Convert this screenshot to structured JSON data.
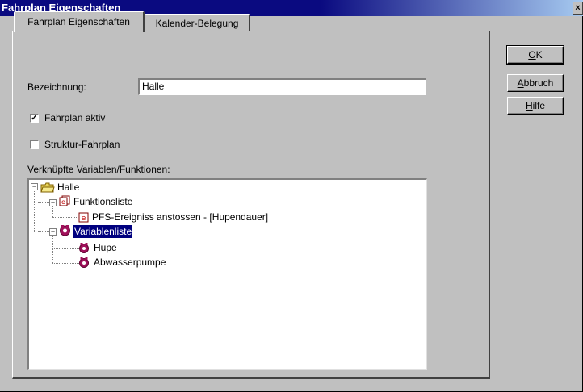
{
  "window": {
    "title": "Fahrplan Eigenschaften",
    "close_label": "×"
  },
  "tabs": [
    {
      "label": "Fahrplan Eigenschaften",
      "active": true
    },
    {
      "label": "Kalender-Belegung",
      "active": false
    }
  ],
  "form": {
    "bezeichnung_label": "Bezeichnung:",
    "bezeichnung_value": "Halle",
    "fahrplan_aktiv": {
      "label": "Fahrplan aktiv",
      "checked": true,
      "check_mark": "✓"
    },
    "struktur_fahrplan": {
      "label": "Struktur-Fahrplan",
      "checked": false
    },
    "variables_label": "Verknüpfte Variablen/Funktionen:"
  },
  "tree": {
    "root": {
      "label": "Halle",
      "icon": "folder-icon",
      "expander": "−"
    },
    "funktionsliste": {
      "label": "Funktionsliste",
      "icon": "function-list-icon",
      "expander": "−"
    },
    "pfs_ereigniss": {
      "label": "PFS-Ereigniss anstossen - [Hupendauer]",
      "icon": "function-icon"
    },
    "variablenliste": {
      "label": "Variablenliste",
      "icon": "variable-list-icon",
      "expander": "−",
      "selected": true
    },
    "hupe": {
      "label": "Hupe",
      "icon": "variable-icon"
    },
    "abwasserpumpe": {
      "label": "Abwasserpumpe",
      "icon": "variable-icon"
    }
  },
  "buttons": {
    "ok": {
      "label": "OK",
      "mnemonic": "O",
      "rest": "K"
    },
    "abbruch": {
      "label": "Abbruch",
      "mnemonic": "A",
      "rest": "bbruch"
    },
    "hilfe": {
      "label": "Hilfe",
      "mnemonic": "H",
      "rest": "ilfe"
    }
  },
  "colors": {
    "title_bar": "#0a0a80",
    "selection": "#00007f",
    "dialog_bg": "#c0c0c0"
  }
}
